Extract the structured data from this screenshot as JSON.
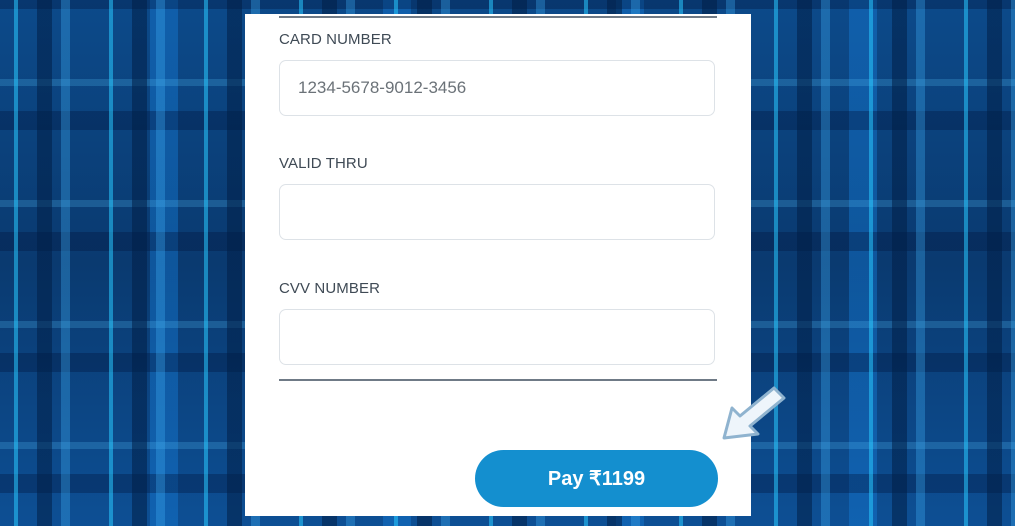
{
  "form": {
    "card_number": {
      "label": "CARD NUMBER",
      "value": "",
      "placeholder": "1234-5678-9012-3456"
    },
    "valid_thru": {
      "label": "VALID THRU",
      "value": "",
      "placeholder": ""
    },
    "cvv": {
      "label": "CVV NUMBER",
      "value": "",
      "placeholder": ""
    },
    "pay_button_label": "Pay ₹1199"
  },
  "colors": {
    "button": "#148fcf",
    "background": "#0a3f78",
    "arrow": "#8fb3cf"
  },
  "icons": {
    "pointer": "arrow-pointer-icon"
  }
}
